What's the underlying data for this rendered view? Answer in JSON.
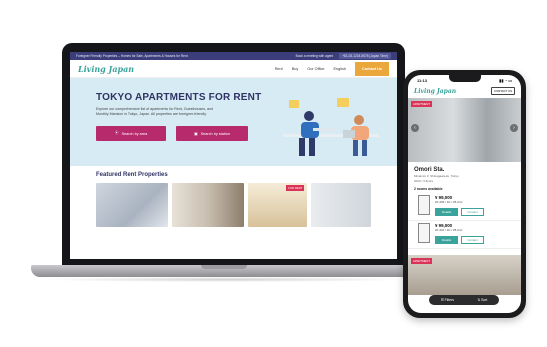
{
  "site": {
    "topbar_text": "Foreigner Friendly Properties – Homes for Sale, Apartments & Houses for Rent",
    "book_meeting": "Book a meeting with agent",
    "phone": "+81-03-1234-5678 (Japan Time)",
    "logo": "Living Japan",
    "nav": [
      "Rent",
      "Buy",
      "Our Office",
      "English"
    ],
    "contact_button": "Contact Us"
  },
  "hero": {
    "title": "TOKYO APARTMENTS FOR RENT",
    "description": "Explore our comprehensive list of apartments for Rent, Guesthouses, and Monthly Mansion in Tokyo, Japan. All properties are foreigner-friendly.",
    "search_area": "Search by area",
    "search_station": "Search by station"
  },
  "featured": {
    "title": "Featured Rent Properties",
    "new_badge": "FOR RENT"
  },
  "phone_app": {
    "time": "11:13",
    "logo": "Living Japan",
    "contact": "CONTACT US",
    "badge": "APARTMENT",
    "station": "Omori Sta.",
    "address": "Minamioi 3, Shinagawa-ku, Tokyo",
    "year": "2023 / 3 floors",
    "rooms_available": "2 rooms available",
    "units": [
      {
        "price": "¥ 99,000",
        "detail": "2F 203 / 1K / 25.2m²",
        "details_btn": "Details",
        "contact_btn": "Contact"
      },
      {
        "price": "¥ 99,000",
        "detail": "2F 201 / 1K / 25.2m²",
        "details_btn": "Details",
        "contact_btn": "Contact"
      }
    ],
    "badge2": "APARTMENT",
    "filters": "Filters",
    "sort": "Sort"
  },
  "colors": {
    "brand_teal": "#3aa39b",
    "navy": "#303364",
    "magenta": "#b72a6b",
    "orange": "#e9a73c"
  }
}
